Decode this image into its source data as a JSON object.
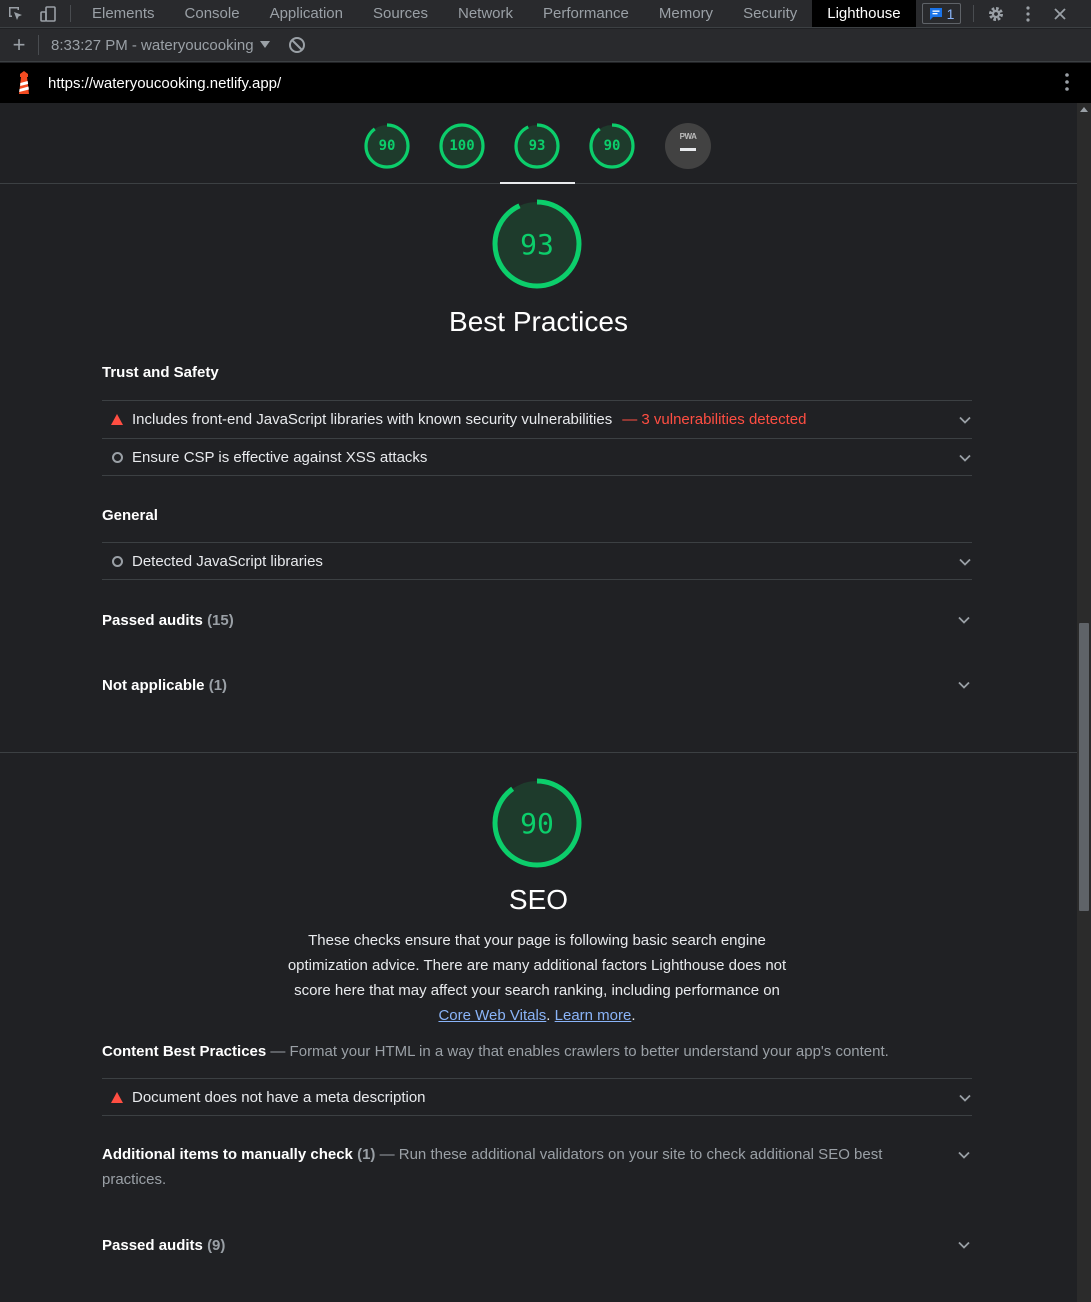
{
  "devtools": {
    "tabs": [
      "Elements",
      "Console",
      "Application",
      "Sources",
      "Network",
      "Performance",
      "Memory",
      "Security",
      "Lighthouse"
    ],
    "active_tab": "Lighthouse",
    "issues_count": "1"
  },
  "lighthouse_toolbar": {
    "report_label": "8:33:27 PM - wateryoucooking"
  },
  "url_bar": {
    "url": "https://wateryoucooking.netlify.app/"
  },
  "score_header": {
    "scores": [
      "90",
      "100",
      "93",
      "90"
    ],
    "pwa_label": "PWA",
    "active_index": 2
  },
  "best_practices": {
    "score": "93",
    "title": "Best Practices",
    "groups": {
      "trust": {
        "title": "Trust and Safety",
        "audits": [
          {
            "text": "Includes front-end JavaScript libraries with known security vulnerabilities",
            "warning": "— 3 vulnerabilities detected",
            "status": "fail"
          },
          {
            "text": "Ensure CSP is effective against XSS attacks",
            "status": "info"
          }
        ]
      },
      "general": {
        "title": "General",
        "audits": [
          {
            "text": "Detected JavaScript libraries",
            "status": "info"
          }
        ]
      }
    },
    "passed": {
      "label": "Passed audits",
      "count": "(15)"
    },
    "not_applicable": {
      "label": "Not applicable",
      "count": "(1)"
    }
  },
  "seo": {
    "score": "90",
    "title": "SEO",
    "description": "These checks ensure that your page is following basic search engine optimization advice. There are many additional factors Lighthouse does not score here that may affect your search ranking, including performance on",
    "link1": "Core Web Vitals",
    "link2": "Learn more",
    "content_group": {
      "title": "Content Best Practices",
      "desc": "— Format your HTML in a way that enables crawlers to better understand your app's content.",
      "audits": [
        {
          "text": "Document does not have a meta description",
          "status": "fail"
        }
      ]
    },
    "manual": {
      "label": "Additional items to manually check",
      "count": "(1)",
      "desc": "— Run these additional validators on your site to check additional SEO best practices."
    },
    "passed": {
      "label": "Passed audits",
      "count": "(9)"
    }
  },
  "colors": {
    "pass": "#0cce6b",
    "fail": "#ff4e42",
    "link": "#8ab4f8"
  }
}
